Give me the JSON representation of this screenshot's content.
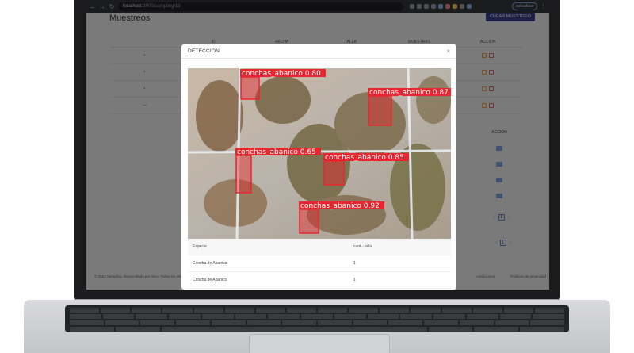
{
  "browser": {
    "url_host": "localhost",
    "url_path": ":3000/sampling/16",
    "profile_label": "actualizar"
  },
  "page": {
    "title": "Muestreos",
    "create_button": "CREAR MUESTREO",
    "table_headers": [
      "ID",
      "FECHA",
      "TALLA",
      "MUESTRAS",
      "ACCION"
    ],
    "rows": [
      {
        "bullet": "•",
        "id": "128"
      },
      {
        "bullet": "•",
        "id": "129"
      },
      {
        "bullet": "•",
        "id": "130"
      },
      {
        "bullet": "—",
        "id": "131"
      }
    ],
    "inner_header": "ACCION",
    "pager_current": "1",
    "footer_left": "© 2023 Sampling. Desarrollado por Vero. Todos los derechos",
    "footer_mid": "condiciones",
    "footer_right": "Políticas de privacidad"
  },
  "modal": {
    "title": "DETECCION",
    "close_icon": "close-icon",
    "detections": [
      {
        "label": "conchas_abanico 0.80"
      },
      {
        "label": "conchas_abanico 0.87"
      },
      {
        "label": "conchas_abanico 0.65"
      },
      {
        "label": "conchas_abanico 0.85"
      },
      {
        "label": "conchas_abanico 0.92"
      }
    ],
    "table": {
      "headers": [
        "Especie",
        "cant - talla"
      ],
      "rows": [
        [
          "Concha de Abanico",
          "1"
        ],
        [
          "Concha de Abanico",
          "1"
        ]
      ]
    }
  },
  "colors": {
    "detection_box": "#e8262f",
    "accent": "#3a3f8f"
  }
}
